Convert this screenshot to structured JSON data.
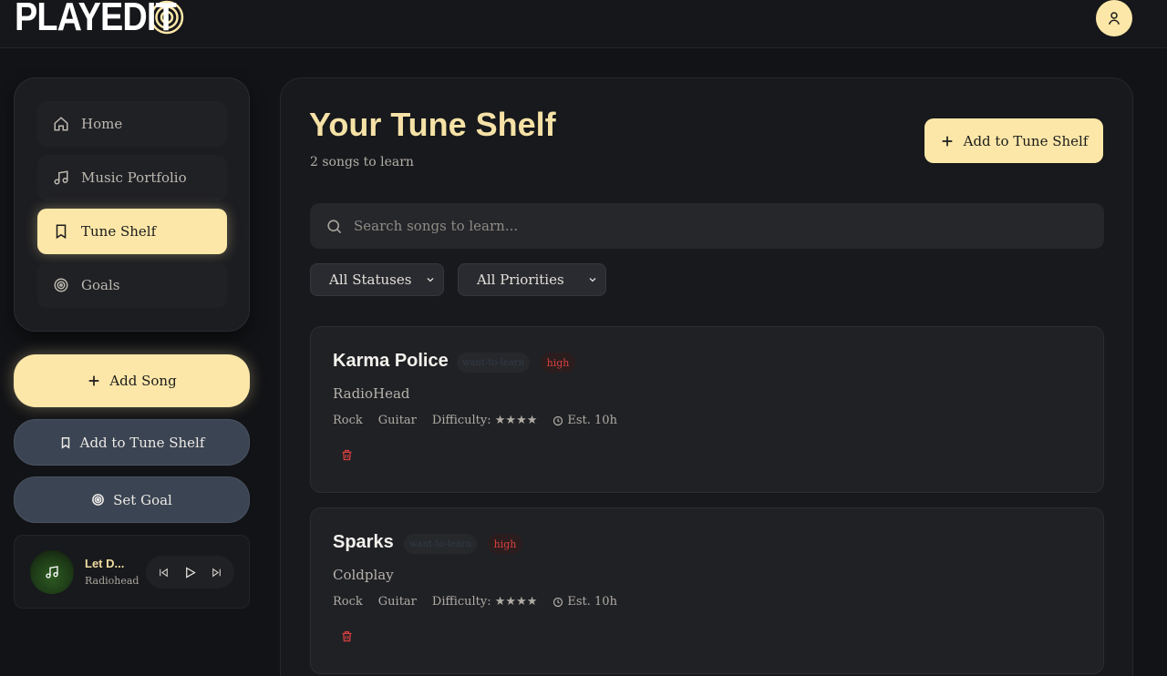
{
  "app": {
    "logo_text": "PLAYEDIT"
  },
  "nav": {
    "items": [
      {
        "label": "Home",
        "icon": "home-icon"
      },
      {
        "label": "Music Portfolio",
        "icon": "music-note-icon"
      },
      {
        "label": "Tune Shelf",
        "icon": "bookmark-icon",
        "active": true
      },
      {
        "label": "Goals",
        "icon": "target-icon"
      }
    ]
  },
  "sidebar_actions": {
    "add_song": "Add Song",
    "add_tune_shelf": "Add to Tune Shelf",
    "set_goal": "Set Goal"
  },
  "player": {
    "title": "Let D...",
    "artist": "Radiohead"
  },
  "main": {
    "title": "Your Tune Shelf",
    "subtitle": "2 songs to learn",
    "add_button": "Add to Tune Shelf",
    "search_placeholder": "Search songs to learn...",
    "filters": {
      "status": "All Statuses",
      "priority": "All Priorities"
    }
  },
  "songs": [
    {
      "title": "Karma Police",
      "status": "want-to-learn",
      "priority": "high",
      "artist": "RadioHead",
      "genre": "Rock",
      "instrument": "Guitar",
      "difficulty": "Difficulty: ★★★★",
      "estimate": "Est. 10h"
    },
    {
      "title": "Sparks",
      "status": "want-to-learn",
      "priority": "high",
      "artist": "Coldplay",
      "genre": "Rock",
      "instrument": "Guitar",
      "difficulty": "Difficulty: ★★★★",
      "estimate": "Est. 10h"
    }
  ],
  "colors": {
    "accent": "#fde7a8",
    "background": "#121316",
    "danger": "#d94040",
    "secondary_button": "#3b4452"
  }
}
